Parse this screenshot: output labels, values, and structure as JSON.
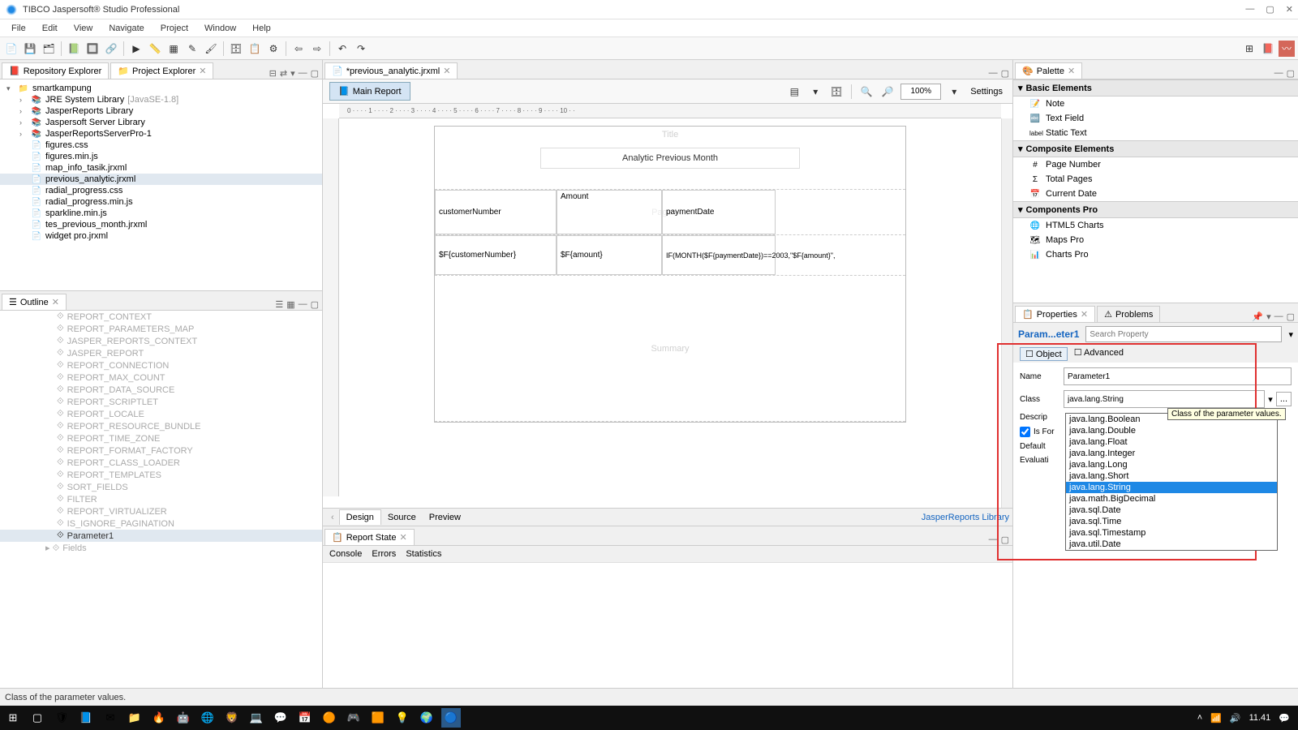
{
  "window": {
    "title": "TIBCO Jaspersoft® Studio Professional"
  },
  "menu": [
    "File",
    "Edit",
    "View",
    "Navigate",
    "Project",
    "Window",
    "Help"
  ],
  "views": {
    "repo_tab": "Repository Explorer",
    "project_tab": "Project Explorer",
    "outline_tab": "Outline",
    "palette_tab": "Palette",
    "properties_tab": "Properties",
    "problems_tab": "Problems",
    "report_state_tab": "Report State"
  },
  "project_tree": {
    "root": "smartkampung",
    "items": [
      {
        "label": "JRE System Library",
        "suffix": "[JavaSE-1.8]"
      },
      {
        "label": "JasperReports Library"
      },
      {
        "label": "Jaspersoft Server Library"
      },
      {
        "label": "JasperReportsServerPro-1"
      },
      {
        "label": "figures.css"
      },
      {
        "label": "figures.min.js"
      },
      {
        "label": "map_info_tasik.jrxml"
      },
      {
        "label": "previous_analytic.jrxml",
        "selected": true
      },
      {
        "label": "radial_progress.css"
      },
      {
        "label": "radial_progress.min.js"
      },
      {
        "label": "sparkline.min.js"
      },
      {
        "label": "tes_previous_month.jrxml"
      },
      {
        "label": "widget pro.jrxml"
      }
    ]
  },
  "outline": {
    "items": [
      "REPORT_CONTEXT",
      "REPORT_PARAMETERS_MAP",
      "JASPER_REPORTS_CONTEXT",
      "JASPER_REPORT",
      "REPORT_CONNECTION",
      "REPORT_MAX_COUNT",
      "REPORT_DATA_SOURCE",
      "REPORT_SCRIPTLET",
      "REPORT_LOCALE",
      "REPORT_RESOURCE_BUNDLE",
      "REPORT_TIME_ZONE",
      "REPORT_FORMAT_FACTORY",
      "REPORT_CLASS_LOADER",
      "REPORT_TEMPLATES",
      "SORT_FIELDS",
      "FILTER",
      "REPORT_VIRTUALIZER",
      "IS_IGNORE_PAGINATION"
    ],
    "active": "Parameter1",
    "last": "Fields"
  },
  "editor": {
    "tab": "*previous_analytic.jrxml",
    "main_report": "Main Report",
    "zoom": "100%",
    "settings": "Settings",
    "bottom_tabs": {
      "design": "Design",
      "source": "Source",
      "preview": "Preview",
      "lib": "JasperReports Library"
    }
  },
  "report": {
    "title_bg": "Title",
    "title": "Analytic Previous Month",
    "page_header_bg": "Page H...",
    "cols": {
      "c1": "customerNumber",
      "c2": "Amount",
      "c3": "paymentDate"
    },
    "fields": {
      "f1": "$F{customerNumber}",
      "f2": "$F{amount}",
      "f3": "IF(MONTH($F{paymentDate})==2003,\"$F{amount}\","
    },
    "summary_bg": "Summary"
  },
  "console": {
    "tabs": [
      "Console",
      "Errors",
      "Statistics"
    ]
  },
  "palette": {
    "cat_basic": "Basic Elements",
    "cat_composite": "Composite Elements",
    "cat_components": "Components Pro",
    "basic": [
      "Note",
      "Text Field",
      "Static Text"
    ],
    "composite": [
      "Page Number",
      "Total Pages",
      "Current Date"
    ],
    "components": [
      "HTML5 Charts",
      "Maps Pro",
      "Charts Pro"
    ]
  },
  "properties": {
    "title": "Param...eter1",
    "search_ph": "Search Property",
    "tab_object": "Object",
    "tab_advanced": "Advanced",
    "name_label": "Name",
    "name_value": "Parameter1",
    "class_label": "Class",
    "class_value": "java.lang.String",
    "descr_label": "Descrip",
    "isfor_label": "Is For",
    "default_label": "Default",
    "eval_label": "Evaluati",
    "tooltip": "Class of the parameter values.",
    "dropdown": [
      "java.lang.Boolean",
      "java.lang.Double",
      "java.lang.Float",
      "java.lang.Integer",
      "java.lang.Long",
      "java.lang.Short",
      "java.lang.String",
      "java.math.BigDecimal",
      "java.sql.Date",
      "java.sql.Time",
      "java.sql.Timestamp",
      "java.util.Date"
    ],
    "dropdown_selected": "java.lang.String"
  },
  "statusbar": "Class of the parameter values.",
  "taskbar": {
    "time": "11.41"
  }
}
